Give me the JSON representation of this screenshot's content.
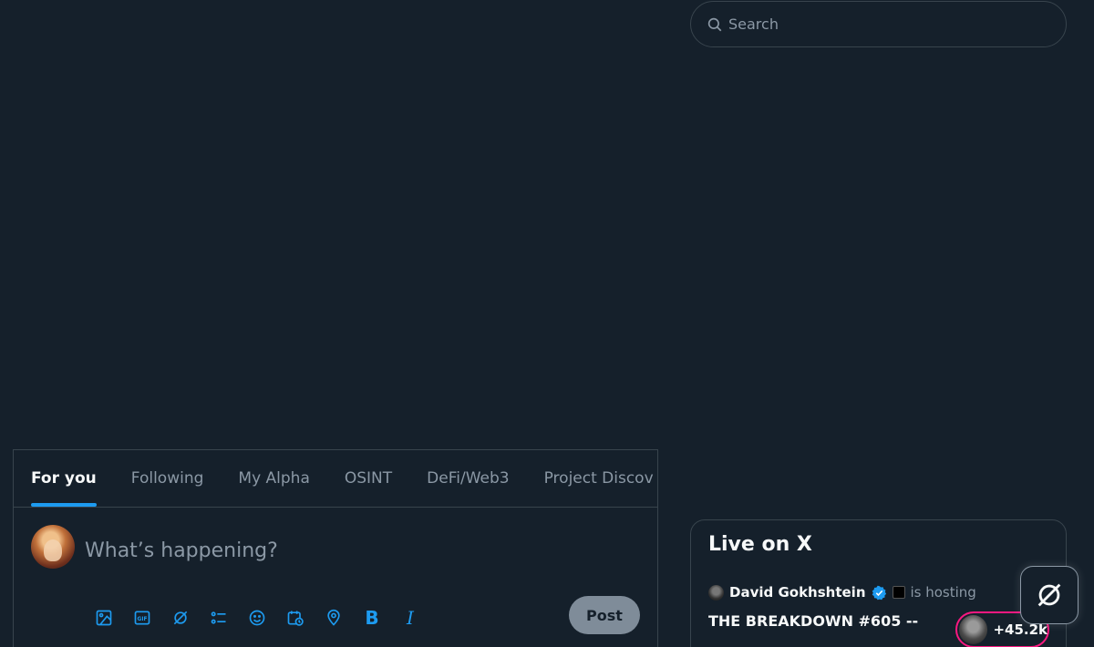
{
  "search": {
    "placeholder": "Search"
  },
  "tabs": [
    {
      "label": "For you",
      "active": true
    },
    {
      "label": "Following",
      "active": false
    },
    {
      "label": "My Alpha",
      "active": false
    },
    {
      "label": "OSINT",
      "active": false
    },
    {
      "label": "DeFi/Web3",
      "active": false
    },
    {
      "label": "Project Discov",
      "active": false
    }
  ],
  "composer": {
    "placeholder": "What’s happening?",
    "post_label": "Post",
    "tools": [
      "media-icon",
      "gif-icon",
      "grok-icon",
      "poll-icon",
      "emoji-icon",
      "schedule-icon",
      "location-icon",
      "bold-icon",
      "italic-icon"
    ],
    "bold_label": "B",
    "italic_label": "I"
  },
  "live": {
    "title": "Live on X",
    "host_name": "David Gokhshtein",
    "host_action": "is hosting",
    "space_title": "THE BREAKDOWN #605 --",
    "listener_count": "+45.2k"
  },
  "colors": {
    "background": "#15202b",
    "accent": "#1d9bf0",
    "border": "#38444d",
    "muted": "#8b98a5",
    "live_ring": "#f91880"
  }
}
